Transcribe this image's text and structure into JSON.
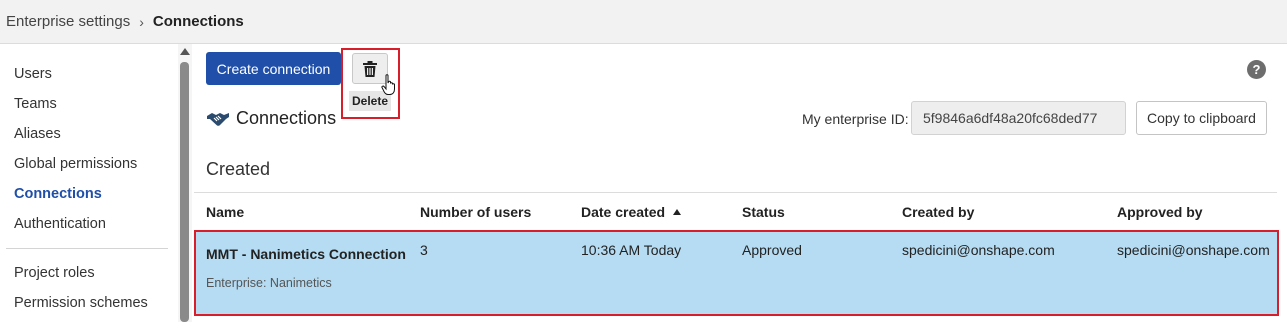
{
  "breadcrumb": {
    "parent": "Enterprise settings",
    "separator": "›",
    "current": "Connections"
  },
  "sidebar": {
    "items": [
      {
        "label": "Users",
        "active": false
      },
      {
        "label": "Teams",
        "active": false
      },
      {
        "label": "Aliases",
        "active": false
      },
      {
        "label": "Global permissions",
        "active": false
      },
      {
        "label": "Connections",
        "active": true
      },
      {
        "label": "Authentication",
        "active": false
      },
      {
        "label": "Project roles",
        "active": false
      },
      {
        "label": "Permission schemes",
        "active": false
      }
    ]
  },
  "toolbar": {
    "create_label": "Create connection",
    "delete_tooltip": "Delete",
    "help_symbol": "?"
  },
  "connections": {
    "title": "Connections",
    "enterprise_id_label": "My enterprise ID:",
    "enterprise_id_value": "5f9846a6df48a20fc68ded77",
    "copy_label": "Copy to clipboard"
  },
  "created": {
    "section_title": "Created",
    "columns": [
      "Name",
      "Number of users",
      "Date created",
      "Status",
      "Created by",
      "Approved by"
    ],
    "sorted_column": "Date created",
    "sort_direction": "ascending",
    "rows": [
      {
        "name": "MMT - Nanimetics Connection",
        "enterprise": "Enterprise: Nanimetics",
        "users": "3",
        "date": "10:36 AM Today",
        "status": "Approved",
        "created_by": "spedicini@onshape.com",
        "approved_by": "spedicini@onshape.com",
        "selected": true
      }
    ]
  },
  "colors": {
    "accent": "#1f4fa8",
    "selection": "#b5dcf2",
    "highlight_border": "#d81e2a"
  },
  "icons": {
    "delete": "trash-icon",
    "connections": "handshake-icon",
    "help": "help-icon",
    "cursor": "hand-pointer-icon"
  }
}
